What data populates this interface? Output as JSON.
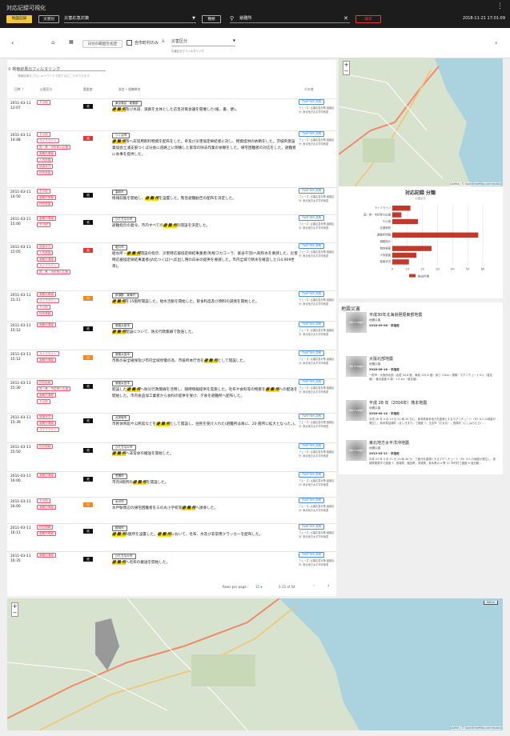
{
  "header": {
    "title": "対応記録可視化",
    "btn_map": "地図記録",
    "btn_disaster": "災害別",
    "disaster_select": "災害応急対策",
    "btn_kind": "種類",
    "search": "避難所",
    "btn_search": "検索",
    "datetime": "2018-11-21 17:01:09"
  },
  "toolbar": {
    "date_range": "日付の範囲を指定",
    "only_municipal": "自市町村のみ",
    "category": "災害区分",
    "category_hint": "災害区分でフィルタリング"
  },
  "filter": {
    "title": "検索結果のフィルタリング",
    "hint": "情報結果をさらにキーワードで絞り込むことができます"
  },
  "table": {
    "headers": [
      "日時 ⇡",
      "災害区分",
      "重要度",
      "発言 • 組織単名",
      "その他"
    ],
    "rows": [
      {
        "date": "2011-03-11 12:07",
        "tags": [
          "その他"
        ],
        "imp": "低",
        "src": "東京港区 · 総務部",
        "pre": "",
        "hl": "避 難 所",
        "post": "及び水道、道路を主体とした応急対策会議を開催した(紙、書、便)。",
        "tw": "TWITTER 共有",
        "ph": "フェーズ: 災害応急対策 組織区分: 東北地方太平洋沖地震"
      },
      {
        "date": "2011-03-11 14:48",
        "tags": [
          "その他",
          "ライフライン",
          "国・県・市町等の応援",
          "避難所情報",
          "人的被害",
          "被害状況",
          "物的被害"
        ],
        "imp": "高",
        "src": "つくば市",
        "pre": "",
        "hl": "避 難 所",
        "post": "等へ非常用飲料物資を配布をした。県及び災害協定締結者に対し、物資提供の依頼をした。茨城県建設業協会土浦支部つくば分会に道路上に倒壊した家等の除去作業の依頼をした。帰宅困難者の対応をした。避難者に食事を提供した。",
        "tw": "TWITTER 共有",
        "ph": "フェーズ: 災害応急対策 組織区分: 東北地方太平洋沖地震"
      },
      {
        "date": "2011-03-11 14:50",
        "tags": [
          "その他",
          "避難所情報",
          "物的被害"
        ],
        "imp": "低",
        "src": "高萩市",
        "pre": "情報収集を開始し、",
        "hl": "避 難 所",
        "post": "を設置した。緊急避難勧告の配布を決定した。",
        "tw": "TWITTER 共有",
        "ph": "フェーズ: 災害応急対策 組織区分: 東北地方太平洋沖地震"
      },
      {
        "date": "2011-03-11 15:00",
        "tags": [
          "避難所情報",
          "その他"
        ],
        "imp": "低",
        "src": "ひたちなか市",
        "pre": "避難指示の発令、市内すべての",
        "hl": "避 難 所",
        "post": "の開設を決定した。",
        "tw": "TWITTER 共有",
        "ph": "フェーズ: 災害応急対策 組織区分: 東北地方太平洋沖地震"
      },
      {
        "date": "2011-03-11 15:05",
        "tags": [
          "被害状況",
          "人的被害",
          "避難所情報",
          "ライフライン",
          "国・県・市町等の応援"
        ],
        "imp": "高",
        "src": "堀川市",
        "pre": "給水所・",
        "hl": "避 難 所",
        "post": "開設の指示、災害時応援協定締結事業者(利根コカコーラ、富谷千羽)へ飲料水を要請した。災害時応援協定締結事業者(JA北つくば)へ炊出し用の白米の提供を要請した。市内全域で断水を確認した(14,909世帯)。",
        "tw": "TWITTER 共有",
        "ph": "フェーズ: 災害応急対策 組織区分: 東北地方太平洋沖地震"
      },
      {
        "date": "2011-03-11 15:11",
        "tags": [
          "避難所情報",
          "ライフライン",
          "その他",
          "物的情報"
        ],
        "imp": "中",
        "src": "那須郡 · 東海村",
        "pre": "",
        "hl": "避 難 所",
        "post": "を15箇所開設した。給水活動を開始した。飲食料品及び燃料の調達を開始した。",
        "tw": "TWITTER 共有",
        "ph": "フェーズ: 災害応急対策 組織区分: 東北地方太平洋沖地震"
      },
      {
        "date": "2011-03-11 15:12",
        "tags": [
          "避難所情報"
        ],
        "imp": "低",
        "src": "常陸大宮市",
        "pre": "",
        "hl": "避 難 所",
        "post": "開設について、防災行政無線で放送した。",
        "tw": "TWITTER 共有",
        "ph": "フェーズ: 災害応急対策 組織区分: 東北地方太平洋沖地震"
      },
      {
        "date": "2011-03-11 15:12",
        "tags": [
          "ライフライン",
          "避難所情報"
        ],
        "imp": "中",
        "src": "常陸大宮市",
        "pre": "市民の安全確保及び市内全域停電の為、市役所本庁舎を",
        "hl": "避 難 所",
        "post": "として開設した。",
        "tw": "TWITTER 共有",
        "ph": "フェーズ: 災害応急対策 組織区分: 東北地方太平洋沖地震"
      },
      {
        "date": "2011-03-11 15:30",
        "tags": [
          "物的被害",
          "国・県・市町等の応援",
          "避難所情報",
          "その他"
        ],
        "imp": "低",
        "src": "常陸太田市",
        "pre": "開設した",
        "hl": "避 難 所",
        "post": "へ防災行政無線を活用し、随時情報提供を実施した。毛布や食料等の物資を",
        "hl2": "避 難 所",
        "post2": "への配送を開始した。市内食品加工業者から食料の提供を受け、夕食を避難所へ配布した。",
        "tw": "TWITTER 共有",
        "ph": "フェーズ: 災害応急対策 組織区分: 東北地方太平洋沖地震"
      },
      {
        "date": "2011-03-11 15:39",
        "tags": [
          "被害状況",
          "避難所情報",
          "ライフライン"
        ],
        "imp": "低",
        "src": "北茨城市",
        "pre": "市民体育館や公民館などを",
        "hl": "避 難 所",
        "post": "として開設し、住民を受け入れた(避難所は後に、20 箇所に拡大となった。)。",
        "tw": "TWITTER 共有",
        "ph": "フェーズ: 災害応急対策 組織区分: 東北地方太平洋沖地震"
      },
      {
        "date": "2011-03-11 15:50",
        "tags": [
          "物的情報"
        ],
        "imp": "低",
        "src": "ひたちなか市",
        "pre": "",
        "hl": "避 難 所",
        "post": "へ非常食の搬送を開始した。",
        "tw": "TWITTER 共有",
        "ph": "フェーズ: 災害応急対策 組織区分: 東北地方太平洋沖地震"
      },
      {
        "date": "2011-03-11 16:00",
        "tags": [
          "避難所情報"
        ],
        "imp": "低",
        "src": "笠間市",
        "pre": "市内9箇所の",
        "hl": "避 難 所",
        "post": "を開設した。",
        "tw": "TWITTER 共有",
        "ph": "フェーズ: 災害応急対策 組織区分: 東北地方太平洋沖地震"
      },
      {
        "date": "2011-03-11 16:00",
        "tags": [
          "その他",
          "避難所情報"
        ],
        "imp": "中",
        "src": "水戸市",
        "pre": "水戸駅周辺の帰宅困難者を三の丸小学校等",
        "hl": "避 難 所",
        "post": "へ誘導した。",
        "tw": "TWITTER 共有",
        "ph": "フェーズ: 災害応急対策 組織区分: 東北地方太平洋沖地震"
      },
      {
        "date": "2011-03-11 16:11",
        "tags": [
          "物的情報",
          "避難所情報"
        ],
        "imp": "低",
        "src": "那珂市",
        "pre": "",
        "hl": "避 難 所",
        "post": "6箇所を設置した。",
        "hl2": "避 難 所",
        "post2": "において、毛布、水及び非常用クラッカーを配布した。",
        "tw": "TWITTER 共有",
        "ph": "フェーズ: 災害応急対策 組織区分: 東北地方太平洋沖地震"
      },
      {
        "date": "2011-03-11 16:35",
        "tags": [
          "避難所情報"
        ],
        "imp": "低",
        "src": "ひたちなか市",
        "pre": "",
        "hl": "避 難 所",
        "post": "へ毛布の搬送を開始した。",
        "tw": "TWITTER 共有",
        "ph": "フェーズ: 災害応急対策 組織区分: 東北地方太平洋沖地震"
      }
    ]
  },
  "pagination": {
    "label": "Rows per page:",
    "per_page": "15",
    "range": "1-15 of 54"
  },
  "map": {
    "zoom_in": "+",
    "zoom_out": "−",
    "attribution": "Leaflet | © OpenStreetMap contributors",
    "scale": "500 m"
  },
  "chart_data": {
    "type": "bar",
    "title": "対応記録 分類",
    "subtitle": "災害区分",
    "categories": [
      "ライフライン",
      "国・県・市町等の応援",
      "その他",
      "支援物資",
      "避難所情報",
      "避難指示",
      "物的被害",
      "人的被害",
      "被害状況"
    ],
    "series": [
      {
        "name": "検出件数",
        "values": [
          12,
          6,
          17,
          0,
          57,
          0,
          26,
          16,
          11
        ]
      }
    ],
    "xlim": [
      0,
      60
    ],
    "xticks": [
      0,
      10,
      20,
      30,
      40,
      50,
      60
    ],
    "color": "#c0392b"
  },
  "disasters": {
    "title": "地震災害",
    "no_image": "No Image",
    "items": [
      {
        "title": "平成30年北海道胆振東部地震",
        "type": "地震災害",
        "date": "2018-09-06 - 未指定",
        "desc": ""
      },
      {
        "title": "大阪北部地震",
        "type": "地震災害",
        "date": "2018-06-18 - 未指定",
        "desc": "一般市・大阪府北部（北緯 34.8 度、東経 135.6 度）深さ 13km・規模・マグニチュード 6.1（暫定値）・最大震度 6 弱：1.5 km（暫定値）"
      },
      {
        "title": "平成 28 年（2016年）熊本地震",
        "type": "地震災害",
        "date": "2016-04-14 - 未指定",
        "desc": "平成 28 年 4 月 14 日 21 時 26 分に、熊本県熊本地方を震源とするマグニチュード（M）6.5 の地震が発生し、熊本県益城町（ましきまち）で震度 7、玉名市（たまな）、西原村（にしはらむら）..."
      },
      {
        "title": "東北地方太平洋沖地震",
        "type": "地震災害",
        "date": "2013-03-11 - 未指定",
        "desc": "平成 23 年 3 月 11 日 14 時 46 分、三陸沖を震源とするマグニチュード（M）9.0 の地震が発生し、宮城県栗原市で震度 7、宮城県、福島県、茨城県、栃木県の 4 県 37 市町村で震度 6 強を観..."
      }
    ]
  }
}
